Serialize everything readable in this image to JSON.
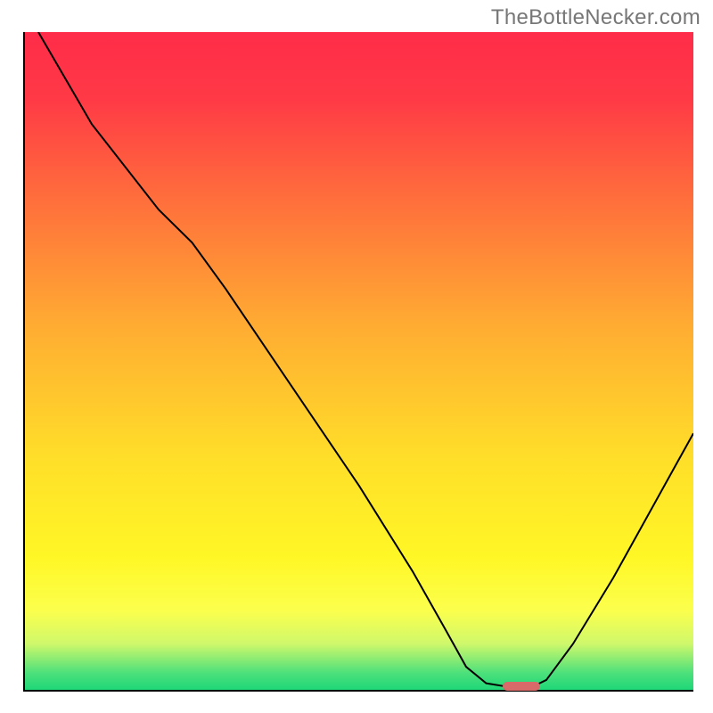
{
  "watermark": "TheBottleNecker.com",
  "gradient_stops": [
    {
      "offset": 0.0,
      "color": "#ff2c49"
    },
    {
      "offset": 0.1,
      "color": "#ff3946"
    },
    {
      "offset": 0.25,
      "color": "#ff6d3c"
    },
    {
      "offset": 0.45,
      "color": "#ffad32"
    },
    {
      "offset": 0.65,
      "color": "#ffdf29"
    },
    {
      "offset": 0.8,
      "color": "#fff726"
    },
    {
      "offset": 0.88,
      "color": "#fbff4d"
    },
    {
      "offset": 0.93,
      "color": "#cff86b"
    },
    {
      "offset": 0.975,
      "color": "#4be07b"
    },
    {
      "offset": 1.0,
      "color": "#1fd778"
    }
  ],
  "chart_data": {
    "type": "line",
    "title": "",
    "xlabel": "",
    "ylabel": "",
    "xlim": [
      0,
      100
    ],
    "ylim": [
      0,
      100
    ],
    "grid": false,
    "curve_points": [
      {
        "x": 2.0,
        "y": 100.0
      },
      {
        "x": 10.0,
        "y": 86.0
      },
      {
        "x": 20.0,
        "y": 73.0
      },
      {
        "x": 25.0,
        "y": 68.0
      },
      {
        "x": 30.0,
        "y": 61.0
      },
      {
        "x": 40.0,
        "y": 46.0
      },
      {
        "x": 50.0,
        "y": 31.0
      },
      {
        "x": 58.0,
        "y": 18.0
      },
      {
        "x": 63.0,
        "y": 9.0
      },
      {
        "x": 66.0,
        "y": 3.5
      },
      {
        "x": 69.0,
        "y": 1.0
      },
      {
        "x": 72.0,
        "y": 0.5
      },
      {
        "x": 76.0,
        "y": 0.5
      },
      {
        "x": 78.0,
        "y": 1.5
      },
      {
        "x": 82.0,
        "y": 7.0
      },
      {
        "x": 88.0,
        "y": 17.0
      },
      {
        "x": 94.0,
        "y": 28.0
      },
      {
        "x": 100.0,
        "y": 39.0
      }
    ],
    "optimal_marker": {
      "x_start": 71.5,
      "x_end": 77.0,
      "y": 0.5,
      "color": "#d96a6a"
    }
  }
}
